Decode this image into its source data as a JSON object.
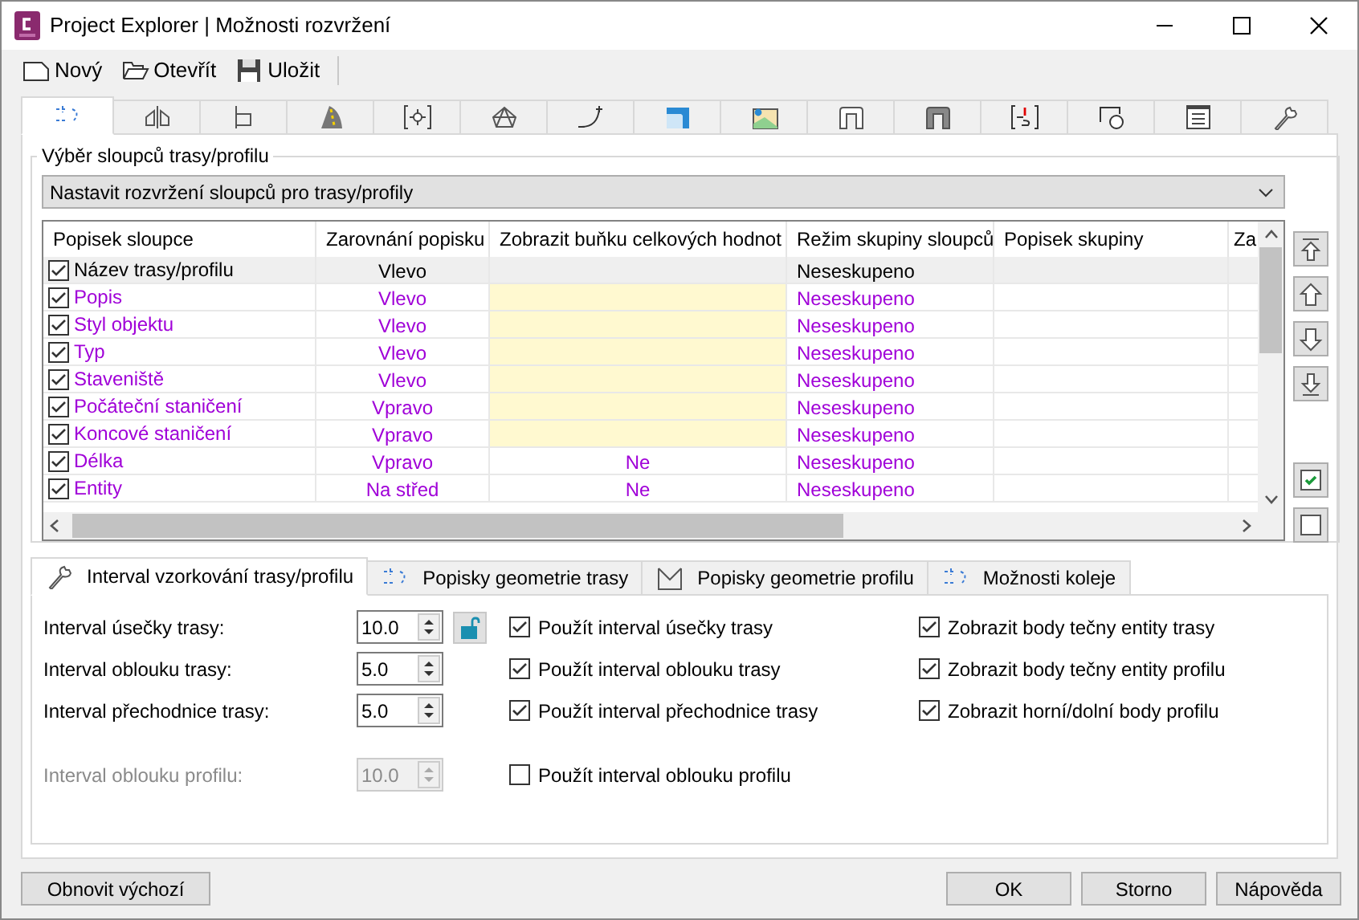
{
  "window": {
    "title": "Project Explorer | Možnosti rozvržení"
  },
  "toolbar": [
    {
      "kind": "new",
      "label": "Nový"
    },
    {
      "kind": "open",
      "label": "Otevřít"
    },
    {
      "kind": "save",
      "label": "Uložit"
    }
  ],
  "icon_tabs": [
    {
      "selected": true
    },
    {
      "selected": false
    },
    {
      "selected": false
    },
    {
      "selected": false
    },
    {
      "selected": false
    },
    {
      "selected": false
    },
    {
      "selected": false
    },
    {
      "selected": false
    },
    {
      "selected": false
    },
    {
      "selected": false
    },
    {
      "selected": false
    },
    {
      "selected": false
    },
    {
      "selected": false
    },
    {
      "selected": false
    },
    {
      "selected": false
    }
  ],
  "group_title": "Výběr sloupců trasy/profilu",
  "layout_dropdown": {
    "value": "Nastavit rozvržení sloupců pro trasy/profily"
  },
  "table": {
    "columns": [
      "Popisek sloupce",
      "Zarovnání popisku",
      "Zobrazit buňku celkových hodnot",
      "Režim skupiny sloupců",
      "Popisek skupiny",
      "Za"
    ],
    "rows": [
      {
        "checked": true,
        "selected": true,
        "label": "Název trasy/profilu",
        "alignment": "Vlevo",
        "total_disabled": false,
        "group_mode": "Neseskupeno"
      },
      {
        "checked": true,
        "selected": false,
        "label": "Popis",
        "alignment": "Vlevo",
        "total_disabled": true,
        "group_mode": "Neseskupeno"
      },
      {
        "checked": true,
        "selected": false,
        "label": "Styl objektu",
        "alignment": "Vlevo",
        "total_disabled": true,
        "group_mode": "Neseskupeno"
      },
      {
        "checked": true,
        "selected": false,
        "label": "Typ",
        "alignment": "Vlevo",
        "total_disabled": true,
        "group_mode": "Neseskupeno"
      },
      {
        "checked": true,
        "selected": false,
        "label": "Staveniště",
        "alignment": "Vlevo",
        "total_disabled": true,
        "group_mode": "Neseskupeno"
      },
      {
        "checked": true,
        "selected": false,
        "label": "Počáteční staničení",
        "alignment": "Vpravo",
        "total_disabled": true,
        "group_mode": "Neseskupeno"
      },
      {
        "checked": true,
        "selected": false,
        "label": "Koncové staničení",
        "alignment": "Vpravo",
        "total_disabled": true,
        "group_mode": "Neseskupeno"
      },
      {
        "checked": true,
        "selected": false,
        "label": "Délka",
        "alignment": "Vpravo",
        "total": "Ne",
        "total_disabled": false,
        "group_mode": "Neseskupeno"
      },
      {
        "checked": true,
        "selected": false,
        "label": "Entity",
        "alignment": "Na střed",
        "total": "Ne",
        "total_disabled": false,
        "group_mode": "Neseskupeno"
      }
    ]
  },
  "side_buttons": [
    {
      "kind": "top"
    },
    {
      "kind": "up"
    },
    {
      "kind": "down"
    },
    {
      "kind": "bottom"
    },
    {
      "kind": "check-all"
    },
    {
      "kind": "uncheck-all"
    }
  ],
  "bottom_tabs": [
    {
      "label": "Interval vzorkování trasy/profilu",
      "selected": true
    },
    {
      "label": "Popisky geometrie trasy",
      "selected": false
    },
    {
      "label": "Popisky geometrie profilu",
      "selected": false
    },
    {
      "label": "Možnosti koleje",
      "selected": false
    }
  ],
  "interval_fields": [
    {
      "label": "Interval úsečky trasy:",
      "value": "10.0",
      "disabled": false,
      "has_lock": true
    },
    {
      "label": "Interval oblouku trasy:",
      "value": "5.0",
      "disabled": false,
      "has_lock": false
    },
    {
      "label": "Interval přechodnice trasy:",
      "value": "5.0",
      "disabled": false,
      "has_lock": false
    },
    {
      "label": "Interval oblouku profilu:",
      "value": "10.0",
      "disabled": true,
      "has_lock": false
    }
  ],
  "use_options": [
    {
      "label": "Použít interval úsečky trasy",
      "checked": true
    },
    {
      "label": "Použít interval oblouku trasy",
      "checked": true
    },
    {
      "label": "Použít interval přechodnice trasy",
      "checked": true
    },
    {
      "label": "Použít interval oblouku profilu",
      "checked": false
    }
  ],
  "display_options": [
    {
      "label": "Zobrazit body tečny entity trasy",
      "checked": true
    },
    {
      "label": "Zobrazit body tečny entity profilu",
      "checked": true
    },
    {
      "label": "Zobrazit horní/dolní body profilu",
      "checked": true
    }
  ],
  "footer": {
    "reset": "Obnovit výchozí",
    "buttons": [
      "OK",
      "Storno",
      "Nápověda"
    ]
  }
}
